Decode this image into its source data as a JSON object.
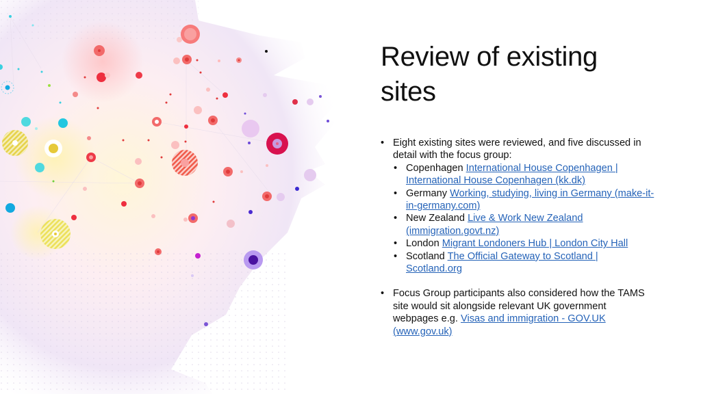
{
  "slide": {
    "title_line1": "Review of existing",
    "title_line2": "sites",
    "bullets": [
      {
        "text": "Eight existing sites were reviewed, and five discussed in detail with the focus group:",
        "sub": [
          {
            "label": "Copenhagen",
            "link": "International House Copenhagen | International House Copenhagen (kk.dk)"
          },
          {
            "label": "Germany",
            "link": "Working, studying, living in Germany (make-it-in-germany.com)"
          },
          {
            "label": "New Zealand",
            "link": "Live & Work New Zealand (immigration.govt.nz)"
          },
          {
            "label": "London",
            "link": "Migrant Londoners Hub | London City Hall"
          },
          {
            "label": "Scotland",
            "link": "The Official Gateway to Scotland | Scotland.org"
          }
        ]
      },
      {
        "text": "Focus Group participants also considered how the TAMS site would sit alongside relevant UK government webpages e.g.",
        "link": "Visas and immigration - GOV.UK (www.gov.uk)"
      }
    ]
  },
  "colors": {
    "link": "#2563b8",
    "text": "#111111"
  }
}
